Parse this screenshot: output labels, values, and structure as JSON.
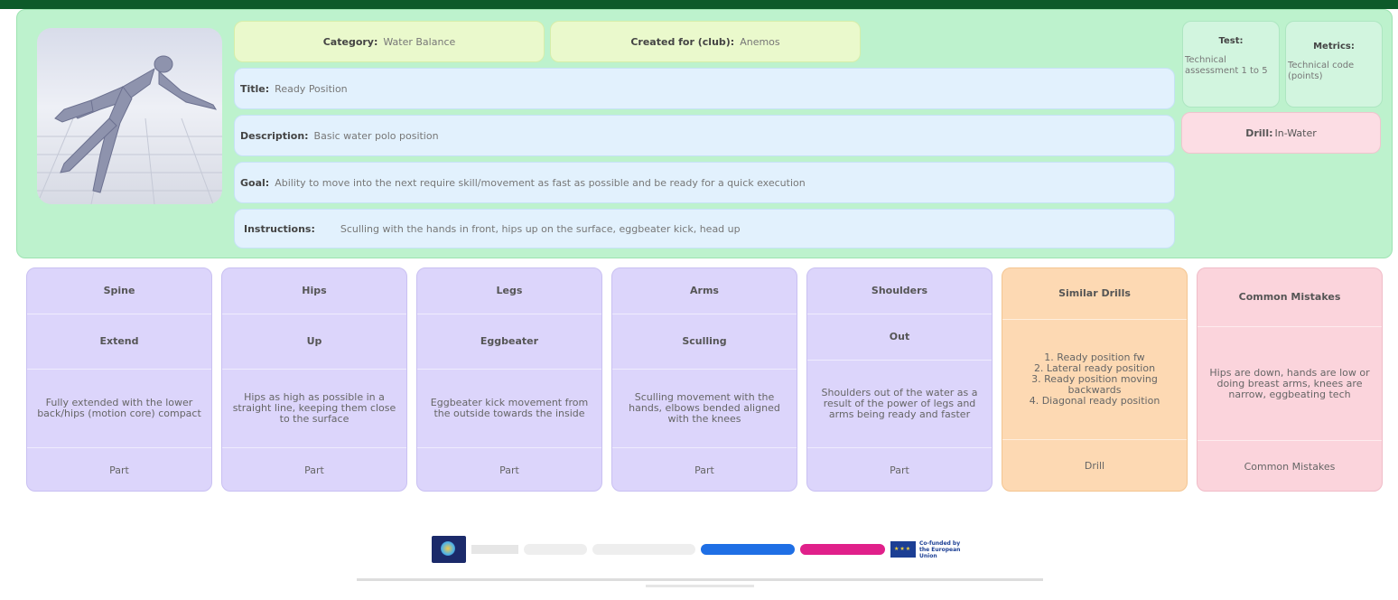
{
  "header": {
    "category_label": "Category:",
    "category_value": "Water Balance",
    "created_label": "Created for (club):",
    "created_value": "Anemos",
    "title_label": "Title:",
    "title_value": "Ready Position",
    "description_label": "Description:",
    "description_value": "Basic water polo position",
    "goal_label": "Goal:",
    "goal_value": "Ability to move into the next require skill/movement as fast as possible and be ready for a quick execution",
    "instructions_label": "Instructions:",
    "instructions_value": "Sculling with the hands in front, hips up on the surface, eggbeater kick, head up",
    "test_label": "Test:",
    "test_value": "Technical assessment 1 to 5",
    "metrics_label": "Metrics:",
    "metrics_value": "Technical code (points)",
    "drill_label": "Drill:",
    "drill_value": "In-Water"
  },
  "cards": [
    {
      "title": "Spine",
      "value": "Extend",
      "description": "Fully extended with the lower back/hips (motion core) compact",
      "type": "Part"
    },
    {
      "title": "Hips",
      "value": "Up",
      "description": "Hips as high as possible in a straight line, keeping them close to the surface",
      "type": "Part"
    },
    {
      "title": "Legs",
      "value": "Eggbeater",
      "description": "Eggbeater kick movement from the outside towards the inside",
      "type": "Part"
    },
    {
      "title": "Arms",
      "value": "Sculling",
      "description": "Sculling movement with the hands, elbows bended aligned with the knees",
      "type": "Part"
    },
    {
      "title": "Shoulders",
      "value": "Out",
      "description": "Shoulders out of the water as a result of the power of legs and arms being ready and faster",
      "type": "Part"
    }
  ],
  "similar_drills": {
    "title": "Similar Drills",
    "items": "1. Ready position fw\n2. Lateral ready position\n3. Ready position moving backwards\n4. Diagonal ready position",
    "type": "Drill"
  },
  "common_mistakes": {
    "title": "Common Mistakes",
    "description": "Hips are down, hands are low or doing breast arms, knees are narrow, eggbeating tech",
    "type": "Common Mistakes"
  },
  "footer": {
    "eu_label": "Co-funded by the European Union"
  },
  "colors": {
    "header_bg": "#bdf2cd",
    "part_card": "#dcd5fb",
    "drill_card": "#fdd9b3",
    "mistake_card": "#fbd4dc"
  }
}
